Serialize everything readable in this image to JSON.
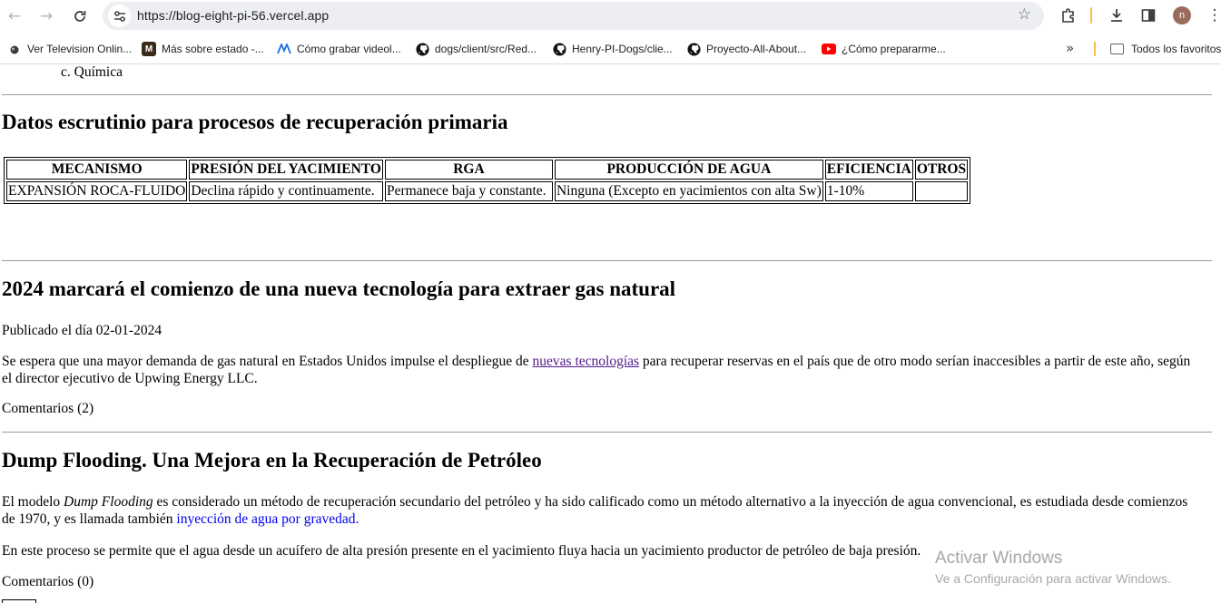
{
  "browser": {
    "url": "https://blog-eight-pi-56.vercel.app",
    "avatar_letter": "n",
    "icons": [
      "back-icon",
      "forward-icon",
      "reload-icon",
      "site-info-icon",
      "bookmark-star-icon",
      "extensions-icon",
      "download-icon",
      "sidepanel-icon",
      "more-menu-icon"
    ]
  },
  "bookmarks": {
    "items": [
      {
        "label": "Ver Television Onlin...",
        "icon": "tv-icon",
        "color": "#2b2b2b"
      },
      {
        "label": "Más sobre estado -...",
        "icon": "m-logo-icon",
        "color": "#3a2a1a"
      },
      {
        "label": "Cómo grabar videol...",
        "icon": "m-wave-icon",
        "color": "#1a73e8"
      },
      {
        "label": "dogs/client/src/Red...",
        "icon": "github-icon",
        "color": "#000000"
      },
      {
        "label": "Henry-PI-Dogs/clie...",
        "icon": "github-icon",
        "color": "#000000"
      },
      {
        "label": "Proyecto-All-About...",
        "icon": "github-icon",
        "color": "#000000"
      },
      {
        "label": "¿Cómo prepararme...",
        "icon": "youtube-icon",
        "color": "#ff0000"
      }
    ],
    "more": "»",
    "all_label": "Todos los favoritos"
  },
  "page": {
    "list_item": "c. Química",
    "section1": {
      "title": "Datos escrutinio para procesos de recuperación primaria",
      "table": {
        "headers": [
          "MECANISMO",
          "PRESIÓN DEL YACIMIENTO",
          "RGA",
          "PRODUCCIÓN DE AGUA",
          "EFICIENCIA",
          "OTROS"
        ],
        "rows": [
          [
            "EXPANSIÓN ROCA-FLUIDO",
            "Declina rápido y continuamente.",
            "Permanece baja y constante.",
            "Ninguna (Excepto en yacimientos con alta Sw)",
            "1-10%",
            ""
          ]
        ]
      }
    },
    "post1": {
      "title": "2024 marcará el comienzo de una nueva tecnología para extraer gas natural",
      "date": "Publicado el día 02-01-2024",
      "text_before": "Se espera que una mayor demanda de gas natural en Estados Unidos impulse el despliegue de ",
      "link": "nuevas tecnologías",
      "text_after": " para recuperar reservas en el país que de otro modo serían inaccesibles a partir de este año, según el director ejecutivo de Upwing Energy LLC.",
      "comments": "Comentarios (2)"
    },
    "post2": {
      "title": "Dump Flooding. Una Mejora en la Recuperación de Petróleo",
      "p1_a": "El modelo ",
      "p1_em": "Dump Flooding",
      "p1_b": " es considerado un método de recuperación secundario del petróleo y ha sido calificado como un método alternativo a la inyección de agua convencional, es estudiada desde comienzos de 1970, y es llamada también ",
      "p1_link": "inyección de agua por gravedad.",
      "p2": "En este proceso se permite que el agua desde un acuífero de alta presión presente en el yacimiento fluya hacia un yacimiento productor de petróleo de baja presión.",
      "comments": "Comentarios (0)"
    }
  },
  "watermark": {
    "line1": "Activar Windows",
    "line2": "Ve a Configuración para activar Windows."
  }
}
